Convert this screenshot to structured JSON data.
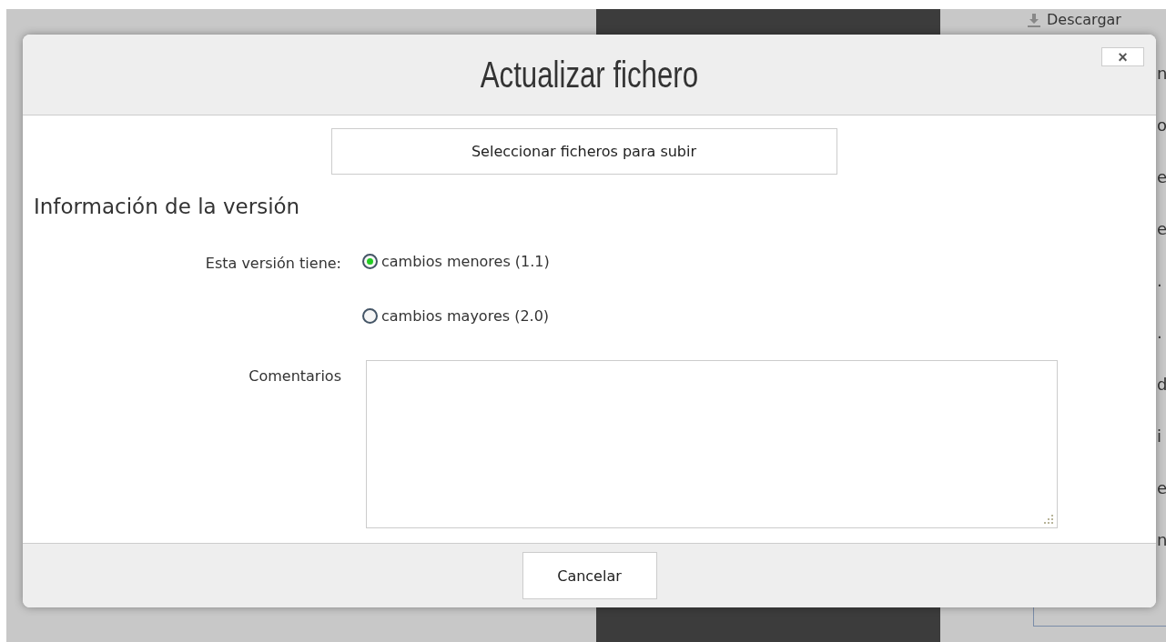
{
  "background": {
    "download_link": "Descargar",
    "fragments": [
      "n",
      "o",
      "e",
      "e",
      ".",
      ".",
      "d",
      "i",
      "e",
      "n"
    ]
  },
  "dialog": {
    "title": "Actualizar fichero",
    "close": "×",
    "upload_button": "Seleccionar ficheros para subir",
    "section_title": "Información de la versión",
    "version_label": "Esta versión tiene:",
    "options": [
      {
        "label": "cambios menores (1.1)",
        "selected": true
      },
      {
        "label": "cambios mayores (2.0)",
        "selected": false
      }
    ],
    "comments_label": "Comentarios",
    "cancel_button": "Cancelar"
  }
}
